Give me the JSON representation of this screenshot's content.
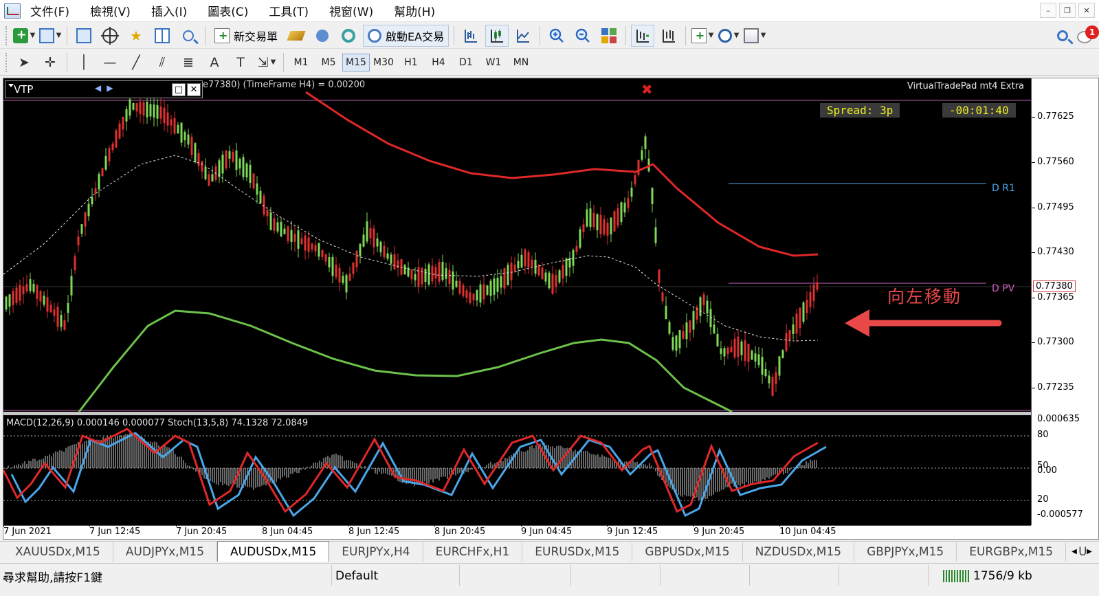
{
  "menu": [
    "文件(F)",
    "檢視(V)",
    "插入(I)",
    "圖表(C)",
    "工具(T)",
    "視窗(W)",
    "幫助(H)"
  ],
  "window_controls": [
    "minimize-icon",
    "restore-icon",
    "close-icon"
  ],
  "toolbar1": {
    "new_order_label": "新交易單",
    "ea_label": "啟動EA交易",
    "notification_count": "1"
  },
  "timeframes": [
    "M1",
    "M5",
    "M15",
    "M30",
    "H1",
    "H4",
    "D1",
    "W1",
    "MN"
  ],
  "active_timeframe": "M15",
  "chart": {
    "header_text": "e77380) (TimeFrame H4) = 0.00200",
    "vtp_panel_title": "VTP",
    "brand": "VirtualTradePad mt4 Extra",
    "spread": "Spread: 3p",
    "countdown": "-00:01:40",
    "level_r1": "D R1",
    "level_pv": "D PV",
    "current_price": "0.77380",
    "annotation": "向左移動",
    "price_labels": [
      "0.77625",
      "0.77560",
      "0.77495",
      "0.77430",
      "0.77365",
      "0.77300",
      "0.77235"
    ],
    "time_labels": [
      "7 Jun 2021",
      "7 Jun 12:45",
      "7 Jun 20:45",
      "8 Jun 04:45",
      "8 Jun 12:45",
      "8 Jun 20:45",
      "9 Jun 04:45",
      "9 Jun 12:45",
      "9 Jun 20:45",
      "10 Jun 04:45"
    ],
    "indicator_header": "MACD(12,26,9) 0.000146 0.000077  Stoch(13,5,8) 74.1328 72.0849",
    "indicator_labels": [
      "0.000635",
      "80",
      "50",
      "0.00",
      "20",
      "-0.000577"
    ],
    "colors": {
      "bull_candle": "#7ed957",
      "bear_candle": "#e03030",
      "upper_band": "#e02828",
      "lower_band": "#6cc24a",
      "stoch_main": "#e02828",
      "stoch_signal": "#4aa6e8",
      "annotation": "#e84848"
    }
  },
  "tabs": [
    "XAUUSDx,M15",
    "AUDJPYx,M15",
    "AUDUSDx,M15",
    "EURJPYx,H4",
    "EURCHFx,H1",
    "EURUSDx,M15",
    "GBPUSDx,M15",
    "NZDUSDx,M15",
    "GBPJPYx,M15",
    "EURGBPx,M15",
    "U"
  ],
  "active_tab": "AUDUSDx,M15",
  "status": {
    "help": "尋求幫助,請按F1鍵",
    "profile": "Default",
    "traffic": "1756/9 kb"
  }
}
